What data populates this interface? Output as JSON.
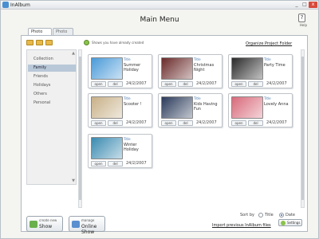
{
  "window": {
    "title": "InAlbum",
    "minimize": "_",
    "maximize": "□",
    "close": "x"
  },
  "header": {
    "title": "Main Menu",
    "help_icon": "?",
    "help_label": "Help"
  },
  "tabs": [
    "Photo Show",
    "Photo Print"
  ],
  "toolbar": {
    "info_text": "Shows you have already created",
    "organize_label": "Organize Project Folder"
  },
  "sidebar": {
    "items": [
      "Collection",
      "Family",
      "Friends",
      "Holidays",
      "Others",
      "Personal"
    ],
    "selected": "Family"
  },
  "cards": [
    {
      "title_tag": "Title",
      "name": "Summer Holiday",
      "date": "24/2/2007",
      "open": "open",
      "del": "del",
      "color": "#4a9ad8"
    },
    {
      "title_tag": "Title",
      "name": "Christmas Night",
      "date": "24/2/2007",
      "open": "open",
      "del": "del",
      "color": "#6a2a2a"
    },
    {
      "title_tag": "Title",
      "name": "Party Time",
      "date": "24/2/2007",
      "open": "open",
      "del": "del",
      "color": "#2a2a2a"
    },
    {
      "title_tag": "Title",
      "name": "Scooter !",
      "date": "24/2/2007",
      "open": "open",
      "del": "del",
      "color": "#c8b088"
    },
    {
      "title_tag": "Title",
      "name": "Kids Having Fun",
      "date": "24/2/2007",
      "open": "open",
      "del": "del",
      "color": "#2a3a5a"
    },
    {
      "title_tag": "Title",
      "name": "Lovely Anna",
      "date": "24/2/2007",
      "open": "open",
      "del": "del",
      "color": "#d86a7a"
    },
    {
      "title_tag": "Title",
      "name": "Winter Holiday",
      "date": "24/2/2007",
      "open": "open",
      "del": "del",
      "color": "#3a8ab0"
    }
  ],
  "bottom": {
    "create_small": "create new",
    "create_big": "Show",
    "manage_small": "manage",
    "manage_big": "Online Show",
    "sort_label": "Sort by",
    "sort_title": "Title",
    "sort_date": "Date",
    "sort_selected": "Date",
    "import_label": "Import previous InAlbum files",
    "settings_label": "Settings"
  }
}
